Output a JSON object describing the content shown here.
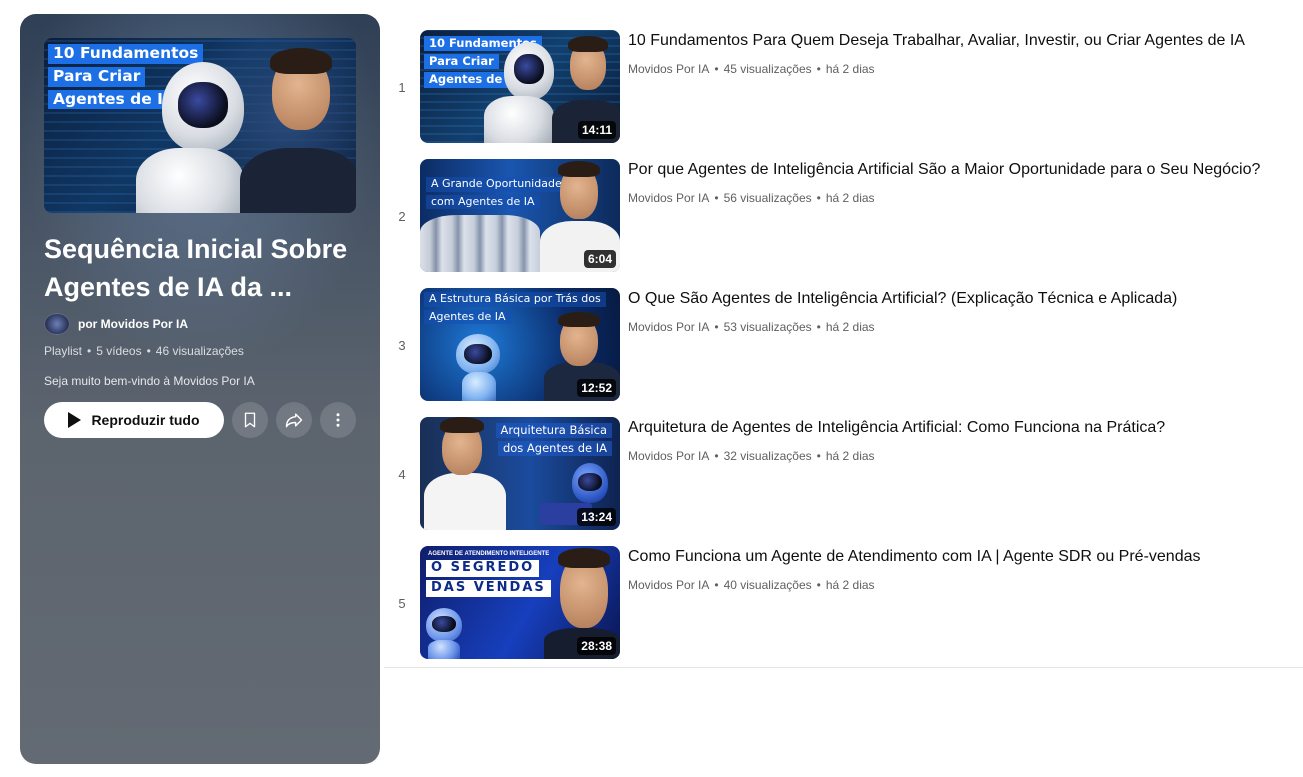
{
  "playlist": {
    "title": "Sequência Inicial Sobre Agentes de IA da ...",
    "owner": "por Movidos Por IA",
    "type": "Playlist",
    "video_count": "5 vídeos",
    "views": "46 visualizações",
    "separator": "•",
    "description": "Seja muito bem-vindo à Movidos Por IA",
    "play_all_label": "Reproduzir tudo",
    "cover_text": [
      "10 Fundamentos",
      "Para Criar",
      "Agentes de IA"
    ],
    "icons": {
      "play": "play-icon",
      "save": "bookmark-icon",
      "share": "share-icon",
      "more": "more-vertical-icon"
    }
  },
  "videos": [
    {
      "index": "1",
      "title": "10 Fundamentos Para Quem Deseja Trabalhar, Avaliar, Investir, ou Criar Agentes de IA",
      "channel": "Movidos Por IA",
      "views": "45 visualizações",
      "age": "há 2 dias",
      "duration": "14:11",
      "thumb_text": [
        "10 Fundamentos",
        "Para Criar",
        "Agentes de IA"
      ]
    },
    {
      "index": "2",
      "title": "Por que Agentes de Inteligência Artificial São a Maior Oportunidade para o Seu Negócio?",
      "channel": "Movidos Por IA",
      "views": "56 visualizações",
      "age": "há 2 dias",
      "duration": "6:04",
      "thumb_text": [
        "A Grande Oportunidade",
        "com Agentes de IA"
      ]
    },
    {
      "index": "3",
      "title": "O Que São Agentes de Inteligência Artificial? (Explicação Técnica e Aplicada)",
      "channel": "Movidos Por IA",
      "views": "53 visualizações",
      "age": "há 2 dias",
      "duration": "12:52",
      "thumb_text": [
        "A Estrutura Básica por Trás dos",
        "Agentes de IA"
      ]
    },
    {
      "index": "4",
      "title": "Arquitetura de Agentes de Inteligência Artificial: Como Funciona na Prática?",
      "channel": "Movidos Por IA",
      "views": "32 visualizações",
      "age": "há 2 dias",
      "duration": "13:24",
      "thumb_text": [
        "Arquitetura Básica",
        "dos Agentes de IA"
      ]
    },
    {
      "index": "5",
      "title": "Como Funciona um Agente de Atendimento com IA | Agente SDR ou Pré-vendas",
      "channel": "Movidos Por IA",
      "views": "40 visualizações",
      "age": "há 2 dias",
      "duration": "28:38",
      "thumb_caption": "AGENTE DE ATENDIMENTO INTELIGENTE",
      "thumb_text": [
        "O SEGREDO",
        "DAS VENDAS"
      ]
    }
  ],
  "meta_separator": "•",
  "colors": {
    "panel_top": "#2f3f55",
    "panel_bottom": "#636a73",
    "thumb_title_bg": "#1d6fe6",
    "secondary_text": "#606060"
  }
}
